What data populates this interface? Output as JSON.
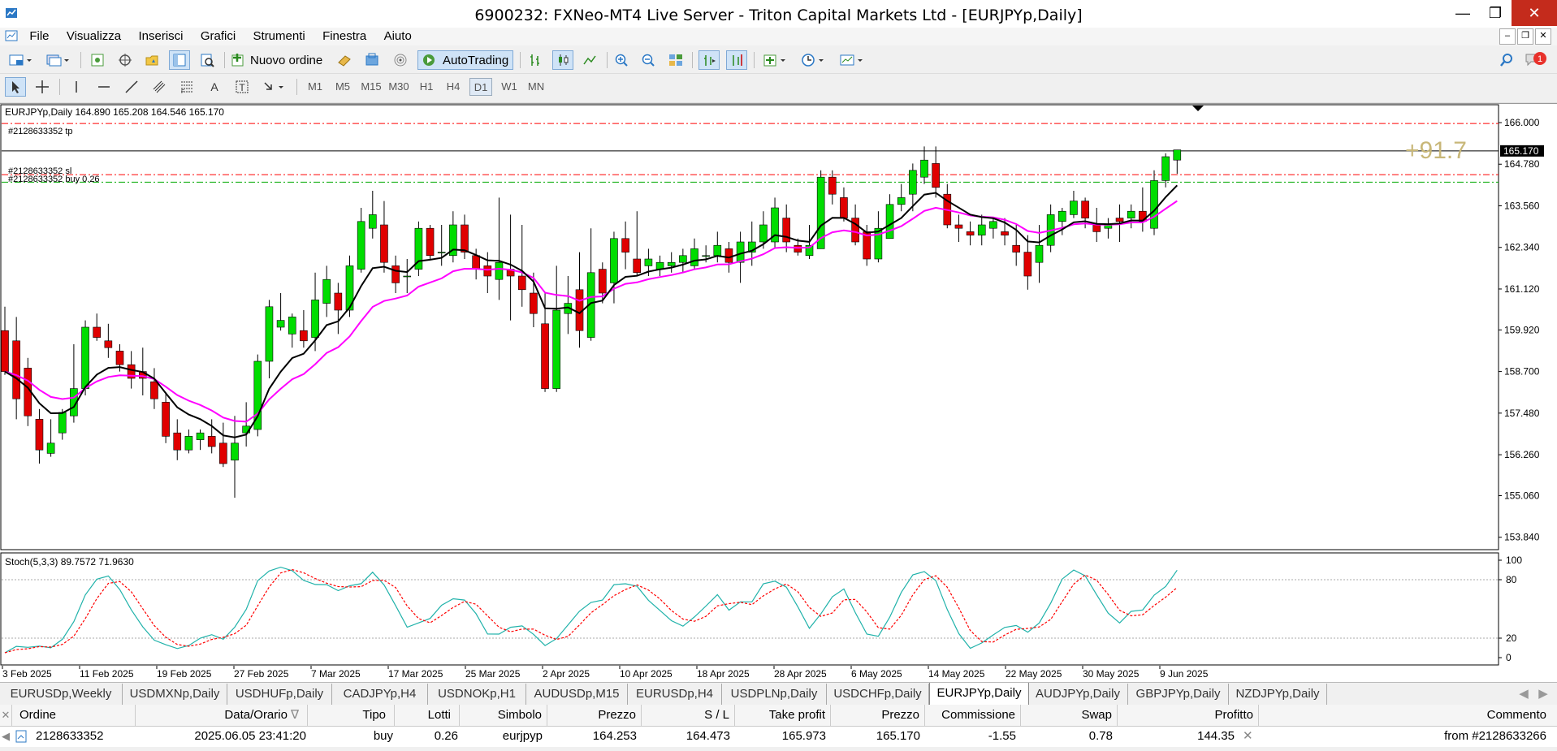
{
  "window": {
    "title": "6900232: FXNeo-MT4 Live Server - Triton Capital Markets Ltd - [EURJPYp,Daily]"
  },
  "menu": [
    "File",
    "Visualizza",
    "Inserisci",
    "Grafici",
    "Strumenti",
    "Finestra",
    "Aiuto"
  ],
  "toolbar": {
    "new_order": "Nuovo ordine",
    "autotrading": "AutoTrading"
  },
  "timeframes": [
    "M1",
    "M5",
    "M15",
    "M30",
    "H1",
    "H4",
    "D1",
    "W1",
    "MN"
  ],
  "active_timeframe": "D1",
  "notification_count": "1",
  "chart": {
    "header": "EURJPYp,Daily  164.890 165.208 164.546 165.170",
    "tp_label": "#2128633352 tp",
    "sl_label": "#2128633352 sl",
    "buy_label": "#2128633352 buy 0.26",
    "profit_overlay": "+91.7",
    "current_price": "165.170",
    "price_ticks": [
      "166.000",
      "164.780",
      "163.560",
      "162.340",
      "161.120",
      "159.920",
      "158.700",
      "157.480",
      "156.260",
      "155.060",
      "153.840"
    ],
    "stoch_label": "Stoch(5,3,3) 89.7572 71.9630",
    "stoch_ticks": [
      "100",
      "80",
      "20",
      "0"
    ],
    "date_ticks": [
      "3 Feb 2025",
      "11 Feb 2025",
      "19 Feb 2025",
      "27 Feb 2025",
      "7 Mar 2025",
      "17 Mar 2025",
      "25 Mar 2025",
      "2 Apr 2025",
      "10 Apr 2025",
      "18 Apr 2025",
      "28 Apr 2025",
      "6 May 2025",
      "14 May 2025",
      "22 May 2025",
      "30 May 2025",
      "9 Jun 2025"
    ],
    "colors": {
      "bull": "#00dd00",
      "bear": "#e00000",
      "ma_fast": "#000000",
      "ma_slow": "#ff00ff",
      "stoch_main": "#20b2aa",
      "stoch_signal": "#ff0000",
      "tp_sl": "#ff0000",
      "entry": "#00aa00"
    }
  },
  "chart_data": {
    "type": "candlestick",
    "symbol": "EURJPYp",
    "timeframe": "Daily",
    "ylim": [
      153.5,
      166.5
    ],
    "candles": [
      [
        159.9,
        160.6,
        158.6,
        158.7
      ],
      [
        159.6,
        160.3,
        157.3,
        157.9
      ],
      [
        158.8,
        159.1,
        157.1,
        157.4
      ],
      [
        157.3,
        157.6,
        156.0,
        156.4
      ],
      [
        156.3,
        157.3,
        156.2,
        156.6
      ],
      [
        156.9,
        157.6,
        156.7,
        157.5
      ],
      [
        157.4,
        159.5,
        157.2,
        158.2
      ],
      [
        158.2,
        160.2,
        158.0,
        160.0
      ],
      [
        160.0,
        160.4,
        159.6,
        159.7
      ],
      [
        159.6,
        160.1,
        159.1,
        159.4
      ],
      [
        159.3,
        159.5,
        158.7,
        158.9
      ],
      [
        158.9,
        159.3,
        158.2,
        158.5
      ],
      [
        158.7,
        159.4,
        158.0,
        158.5
      ],
      [
        158.4,
        158.8,
        157.6,
        157.9
      ],
      [
        157.8,
        158.1,
        156.6,
        156.8
      ],
      [
        156.9,
        157.3,
        156.1,
        156.4
      ],
      [
        156.4,
        157.0,
        156.3,
        156.8
      ],
      [
        156.7,
        157.0,
        156.4,
        156.9
      ],
      [
        156.8,
        157.3,
        156.3,
        156.5
      ],
      [
        156.6,
        157.2,
        155.9,
        156.0
      ],
      [
        156.1,
        157.4,
        155.0,
        156.6
      ],
      [
        156.9,
        157.8,
        156.5,
        157.1
      ],
      [
        157.0,
        159.2,
        156.8,
        159.0
      ],
      [
        159.0,
        160.8,
        158.5,
        160.6
      ],
      [
        160.0,
        161.0,
        159.9,
        160.2
      ],
      [
        159.8,
        160.4,
        159.4,
        160.3
      ],
      [
        159.9,
        160.5,
        159.4,
        159.6
      ],
      [
        159.7,
        161.6,
        159.3,
        160.8
      ],
      [
        160.7,
        161.8,
        160.3,
        161.4
      ],
      [
        161.0,
        161.3,
        159.8,
        160.5
      ],
      [
        160.5,
        162.1,
        160.3,
        161.8
      ],
      [
        161.7,
        163.5,
        161.6,
        163.1
      ],
      [
        162.9,
        164.0,
        162.6,
        163.3
      ],
      [
        163.0,
        163.7,
        161.6,
        161.9
      ],
      [
        161.8,
        162.1,
        161.0,
        161.3
      ],
      [
        161.5,
        162.0,
        161.0,
        161.5
      ],
      [
        161.7,
        163.1,
        161.5,
        162.9
      ],
      [
        162.9,
        163.0,
        162.0,
        162.1
      ],
      [
        162.2,
        163.0,
        161.8,
        162.2
      ],
      [
        162.1,
        163.4,
        161.9,
        163.0
      ],
      [
        163.0,
        163.3,
        162.0,
        162.2
      ],
      [
        162.1,
        162.3,
        161.4,
        161.7
      ],
      [
        161.8,
        162.2,
        161.0,
        161.5
      ],
      [
        161.4,
        163.8,
        160.8,
        161.9
      ],
      [
        161.7,
        163.3,
        160.2,
        161.5
      ],
      [
        161.5,
        163.0,
        160.6,
        161.1
      ],
      [
        161.0,
        161.6,
        160.0,
        160.4
      ],
      [
        160.1,
        161.0,
        158.1,
        158.2
      ],
      [
        158.2,
        161.8,
        158.1,
        160.5
      ],
      [
        160.4,
        161.5,
        159.8,
        160.7
      ],
      [
        161.1,
        162.2,
        159.4,
        159.9
      ],
      [
        159.7,
        162.9,
        159.6,
        161.6
      ],
      [
        161.7,
        161.9,
        160.7,
        161.0
      ],
      [
        161.3,
        162.8,
        160.7,
        162.6
      ],
      [
        162.6,
        163.1,
        161.7,
        162.2
      ],
      [
        162.0,
        163.4,
        161.5,
        161.6
      ],
      [
        161.8,
        162.3,
        161.5,
        162.0
      ],
      [
        161.7,
        162.1,
        161.5,
        161.9
      ],
      [
        161.8,
        162.2,
        161.6,
        161.9
      ],
      [
        161.9,
        162.3,
        161.6,
        162.1
      ],
      [
        161.8,
        162.6,
        161.7,
        162.3
      ],
      [
        162.1,
        162.4,
        161.9,
        162.1
      ],
      [
        162.1,
        162.8,
        161.9,
        162.4
      ],
      [
        162.3,
        162.5,
        161.6,
        161.9
      ],
      [
        161.9,
        162.8,
        161.3,
        162.5
      ],
      [
        162.2,
        163.1,
        161.8,
        162.5
      ],
      [
        162.5,
        163.4,
        162.3,
        163.0
      ],
      [
        162.5,
        163.8,
        162.3,
        163.5
      ],
      [
        163.2,
        163.6,
        162.2,
        162.5
      ],
      [
        162.4,
        162.6,
        162.1,
        162.2
      ],
      [
        162.1,
        163.0,
        162.0,
        162.4
      ],
      [
        162.3,
        164.6,
        162.3,
        164.4
      ],
      [
        164.4,
        164.6,
        163.6,
        163.9
      ],
      [
        163.8,
        164.1,
        163.1,
        163.2
      ],
      [
        163.2,
        163.6,
        162.4,
        162.5
      ],
      [
        162.8,
        163.0,
        161.8,
        162.0
      ],
      [
        162.0,
        163.4,
        161.9,
        162.9
      ],
      [
        162.6,
        163.9,
        162.6,
        163.6
      ],
      [
        163.6,
        164.2,
        163.4,
        163.8
      ],
      [
        163.9,
        164.8,
        163.4,
        164.6
      ],
      [
        164.4,
        165.3,
        164.2,
        164.9
      ],
      [
        164.8,
        165.3,
        163.8,
        164.1
      ],
      [
        163.9,
        164.2,
        162.9,
        163.0
      ],
      [
        163.0,
        163.3,
        162.5,
        162.9
      ],
      [
        162.8,
        163.1,
        162.4,
        162.7
      ],
      [
        162.7,
        163.3,
        162.4,
        163.0
      ],
      [
        162.9,
        163.2,
        162.6,
        163.1
      ],
      [
        162.8,
        163.2,
        162.4,
        162.7
      ],
      [
        162.4,
        163.0,
        161.8,
        162.2
      ],
      [
        162.2,
        162.7,
        161.1,
        161.5
      ],
      [
        161.9,
        163.0,
        161.3,
        162.4
      ],
      [
        162.4,
        163.6,
        162.2,
        163.3
      ],
      [
        163.1,
        163.5,
        162.7,
        163.4
      ],
      [
        163.3,
        164.0,
        163.2,
        163.7
      ],
      [
        163.7,
        163.8,
        162.9,
        163.2
      ],
      [
        163.0,
        163.5,
        162.5,
        162.8
      ],
      [
        162.9,
        163.2,
        162.6,
        163.0
      ],
      [
        163.2,
        163.6,
        162.5,
        163.1
      ],
      [
        163.2,
        163.6,
        162.9,
        163.4
      ],
      [
        163.4,
        164.1,
        162.8,
        163.1
      ],
      [
        162.9,
        164.6,
        162.7,
        164.3
      ],
      [
        164.3,
        165.1,
        164.1,
        165.0
      ],
      [
        164.9,
        165.2,
        164.5,
        165.2
      ]
    ],
    "levels": {
      "take_profit": 165.973,
      "stop_loss": 164.473,
      "entry": 164.253,
      "bid": 165.17
    },
    "indicator": {
      "name": "Stoch(5,3,3)",
      "main": 89.7572,
      "signal": 71.963,
      "levels": [
        80,
        20
      ]
    }
  },
  "tabs": [
    "EURUSDp,Weekly",
    "USDMXNp,Daily",
    "USDHUFp,Daily",
    "CADJPYp,H4",
    "USDNOKp,H1",
    "AUDUSDp,M15",
    "EURUSDp,H4",
    "USDPLNp,Daily",
    "USDCHFp,Daily",
    "EURJPYp,Daily",
    "AUDJPYp,Daily",
    "GBPJPYp,Daily",
    "NZDJPYp,Daily"
  ],
  "active_tab": "EURJPYp,Daily",
  "orders": {
    "headers": [
      "Ordine",
      "Data/Orario",
      "Tipo",
      "Lotti",
      "Simbolo",
      "Prezzo",
      "S / L",
      "Take profit",
      "Prezzo",
      "Commissione",
      "Swap",
      "Profitto",
      "Commento"
    ],
    "rows": [
      [
        "2128633352",
        "2025.06.05 23:41:20",
        "buy",
        "0.26",
        "eurjpyp",
        "164.253",
        "164.473",
        "165.973",
        "165.170",
        "-1.55",
        "0.78",
        "144.35",
        "from #2128633266"
      ]
    ]
  }
}
